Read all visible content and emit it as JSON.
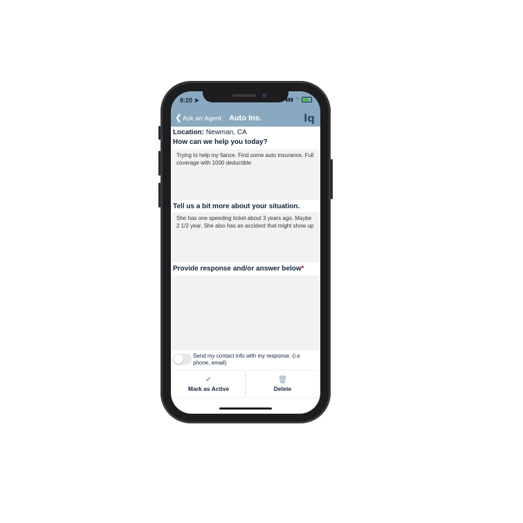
{
  "status": {
    "time": "8:20",
    "location_icon": "location-arrow-icon",
    "signal_icon": "signal-icon",
    "wifi_icon": "wifi-icon",
    "battery_icon": "battery-icon"
  },
  "nav": {
    "back_label": "Ask an Agent",
    "title": "Auto Ins.",
    "logo": "lq"
  },
  "location": {
    "label": "Location:",
    "value": "Newman, CA"
  },
  "questions": [
    {
      "label": "How can we help you today?",
      "answer": "Trying to help my fiance. Find some auto insurance. Full coverage with 1000 deductible"
    },
    {
      "label": "Tell us a bit more about your situation.",
      "answer": "She has one speeding ticket about 3 years ago. Maybe 2 1/2 year. She also has an accident that might show up"
    }
  ],
  "response": {
    "label": "Provide response and/or answer below",
    "required_mark": "*",
    "value": ""
  },
  "contact_toggle": {
    "text": "Send my contact info with my response. (i.e phone, email)",
    "on": false
  },
  "actions": {
    "mark_active": "Mark as Active",
    "delete": "Delete"
  },
  "colors": {
    "header": "#88a9bf",
    "text_dark": "#14233b",
    "field_bg": "#f2f2f2",
    "required": "#d9001b"
  }
}
